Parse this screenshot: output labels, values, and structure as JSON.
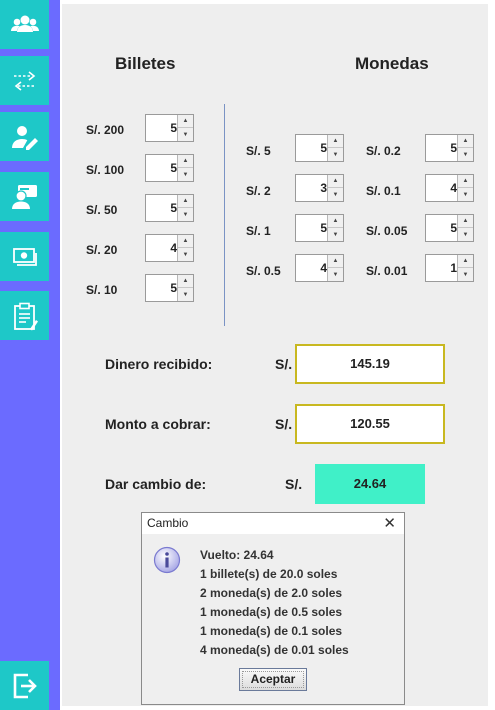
{
  "sidebar": {
    "items": [
      {
        "name": "users-icon"
      },
      {
        "name": "transfer-icon"
      },
      {
        "name": "user-edit-icon"
      },
      {
        "name": "user-card-icon"
      },
      {
        "name": "cash-icon"
      },
      {
        "name": "report-icon"
      }
    ],
    "logout": {
      "name": "logout-icon"
    }
  },
  "billetes": {
    "title": "Billetes",
    "items": [
      {
        "label": "S/. 200",
        "value": "5"
      },
      {
        "label": "S/. 100",
        "value": "5"
      },
      {
        "label": "S/. 50",
        "value": "5"
      },
      {
        "label": "S/. 20",
        "value": "4"
      },
      {
        "label": "S/. 10",
        "value": "5"
      }
    ]
  },
  "monedas": {
    "title": "Monedas",
    "left": [
      {
        "label": "S/. 5",
        "value": "5"
      },
      {
        "label": "S/. 2",
        "value": "3"
      },
      {
        "label": "S/. 1",
        "value": "5"
      },
      {
        "label": "S/. 0.5",
        "value": "4"
      }
    ],
    "right": [
      {
        "label": "S/. 0.2",
        "value": "5"
      },
      {
        "label": "S/. 0.1",
        "value": "4"
      },
      {
        "label": "S/. 0.05",
        "value": "5"
      },
      {
        "label": "S/. 0.01",
        "value": "1"
      }
    ]
  },
  "summary": {
    "received_label": "Dinero recibido:",
    "received_currency": "S/.",
    "received_value": "145.19",
    "charge_label": "Monto a cobrar:",
    "charge_currency": "S/.",
    "charge_value": "120.55",
    "change_label": "Dar cambio de:",
    "change_currency": "S/.",
    "change_value": "24.64"
  },
  "dialog": {
    "title": "Cambio",
    "close": "✕",
    "lines": [
      "Vuelto: 24.64",
      "1 billete(s) de 20.0 soles",
      "2 moneda(s) de 2.0 soles",
      "1 moneda(s) de 0.5 soles",
      "1 moneda(s) de 0.1 soles",
      "4 moneda(s) de 0.01 soles"
    ],
    "ok_label": "Aceptar"
  },
  "colors": {
    "sidebar": "#6b6bff",
    "sidebar_button": "#1ec8c8",
    "amount_border": "#c8b820",
    "change_fill": "#40f0c8"
  }
}
